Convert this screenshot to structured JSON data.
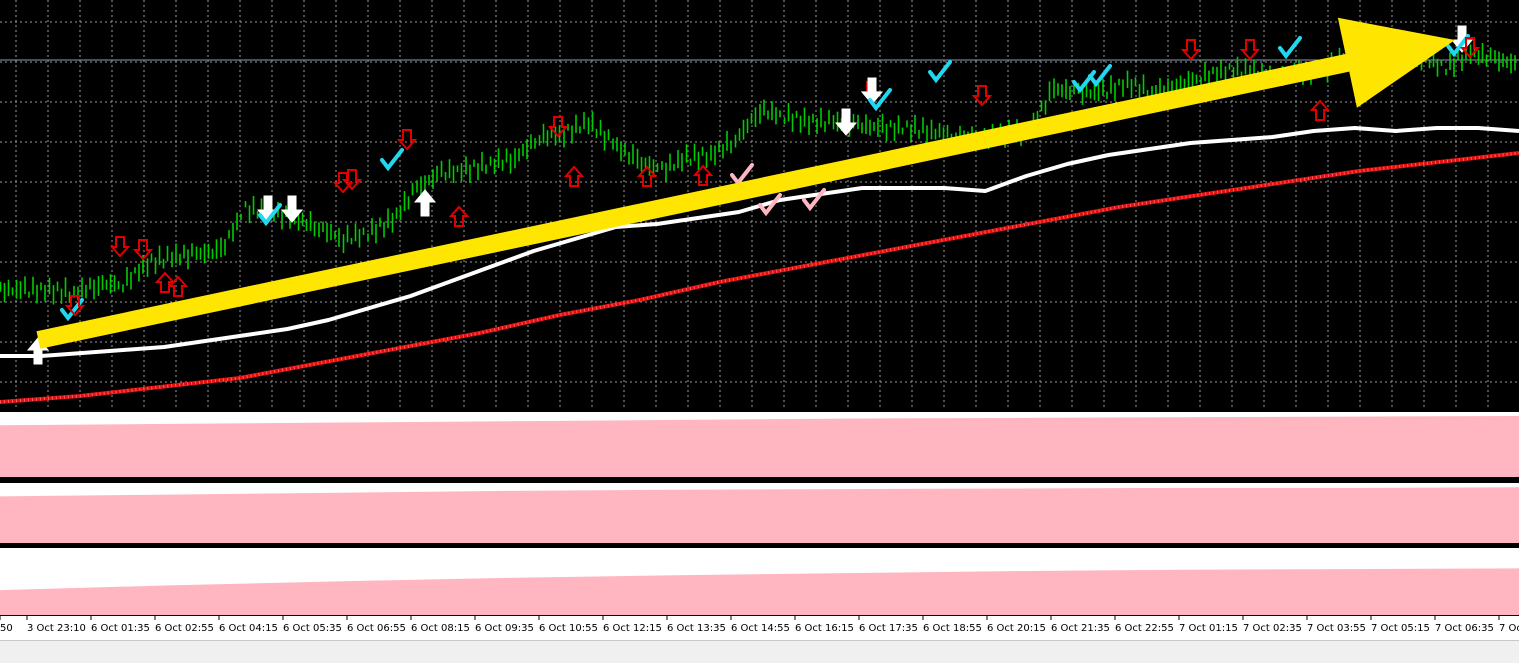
{
  "colors": {
    "background": "#000000",
    "grid": "#9a9a9a",
    "candle_up": "#00cc00",
    "moving_average_fast": "#ffffff",
    "moving_average_slow": "#e01010",
    "trend_arrow": "#ffe600",
    "signal_down": "#e00000",
    "signal_check": "#20d8f0",
    "indicator_fill": "#ffb6c1",
    "time_axis_bg": "#ffffff"
  },
  "chart_data": {
    "type": "line",
    "title": "",
    "xlabel": "",
    "ylabel": "",
    "grid": true,
    "x_ticks": [
      "50",
      "3 Oct 23:10",
      "6 Oct 01:35",
      "6 Oct 02:55",
      "6 Oct 04:15",
      "6 Oct 05:35",
      "6 Oct 06:55",
      "6 Oct 08:15",
      "6 Oct 09:35",
      "6 Oct 10:55",
      "6 Oct 12:15",
      "6 Oct 13:35",
      "6 Oct 14:55",
      "6 Oct 16:15",
      "6 Oct 17:35",
      "6 Oct 18:55",
      "6 Oct 20:15",
      "6 Oct 21:35",
      "6 Oct 22:55",
      "7 Oct 01:15",
      "7 Oct 02:35",
      "7 Oct 03:55",
      "7 Oct 05:15",
      "7 Oct 06:35",
      "7 Oc"
    ],
    "price_range_relative": [
      0,
      100
    ],
    "series": [
      {
        "kind": "candles",
        "values": [
          20,
          20,
          20,
          19,
          22,
          22,
          29,
          31,
          32,
          33,
          47,
          46,
          44,
          41,
          37,
          39,
          43,
          54,
          59,
          60,
          62,
          64,
          71,
          72,
          76,
          69,
          63,
          60,
          64,
          65,
          70,
          80,
          78,
          76,
          76,
          75,
          74,
          74,
          73,
          71,
          71,
          72,
          73,
          87,
          86,
          86,
          89,
          86,
          88,
          91,
          93,
          93,
          91,
          92,
          93,
          98,
          98,
          95,
          98,
          94,
          99,
          97,
          95
        ]
      },
      {
        "kind": "moving-average-fast",
        "values": [
          18,
          18,
          19,
          20,
          21,
          23,
          25,
          27,
          30,
          34,
          38,
          43,
          48,
          53,
          57,
          61,
          62,
          64,
          66,
          70,
          72,
          74,
          74,
          74,
          73,
          78,
          82,
          85,
          87,
          89,
          90,
          91,
          93,
          94,
          93,
          94,
          94,
          93
        ]
      },
      {
        "kind": "moving-average-slow",
        "values": [
          2,
          4,
          7,
          10,
          15,
          20,
          25,
          31,
          36,
          42,
          47,
          52,
          57,
          62,
          67,
          71,
          75,
          79,
          82,
          85
        ]
      }
    ],
    "indicator_panels": [
      {
        "fill_relative": [
          0.8,
          0.82,
          0.84,
          0.86,
          0.88,
          0.9,
          0.91,
          0.92,
          0.93,
          0.94
        ]
      },
      {
        "fill_relative": [
          0.78,
          0.81,
          0.84,
          0.87,
          0.89,
          0.9,
          0.91,
          0.92,
          0.92,
          0.93
        ]
      },
      {
        "fill_relative": [
          0.38,
          0.45,
          0.51,
          0.56,
          0.6,
          0.63,
          0.66,
          0.68,
          0.69,
          0.7
        ]
      }
    ],
    "trend_arrow": {
      "direction": "up",
      "from_relative": [
        0.02,
        0.18
      ],
      "to_relative": [
        0.98,
        1.0
      ]
    }
  }
}
